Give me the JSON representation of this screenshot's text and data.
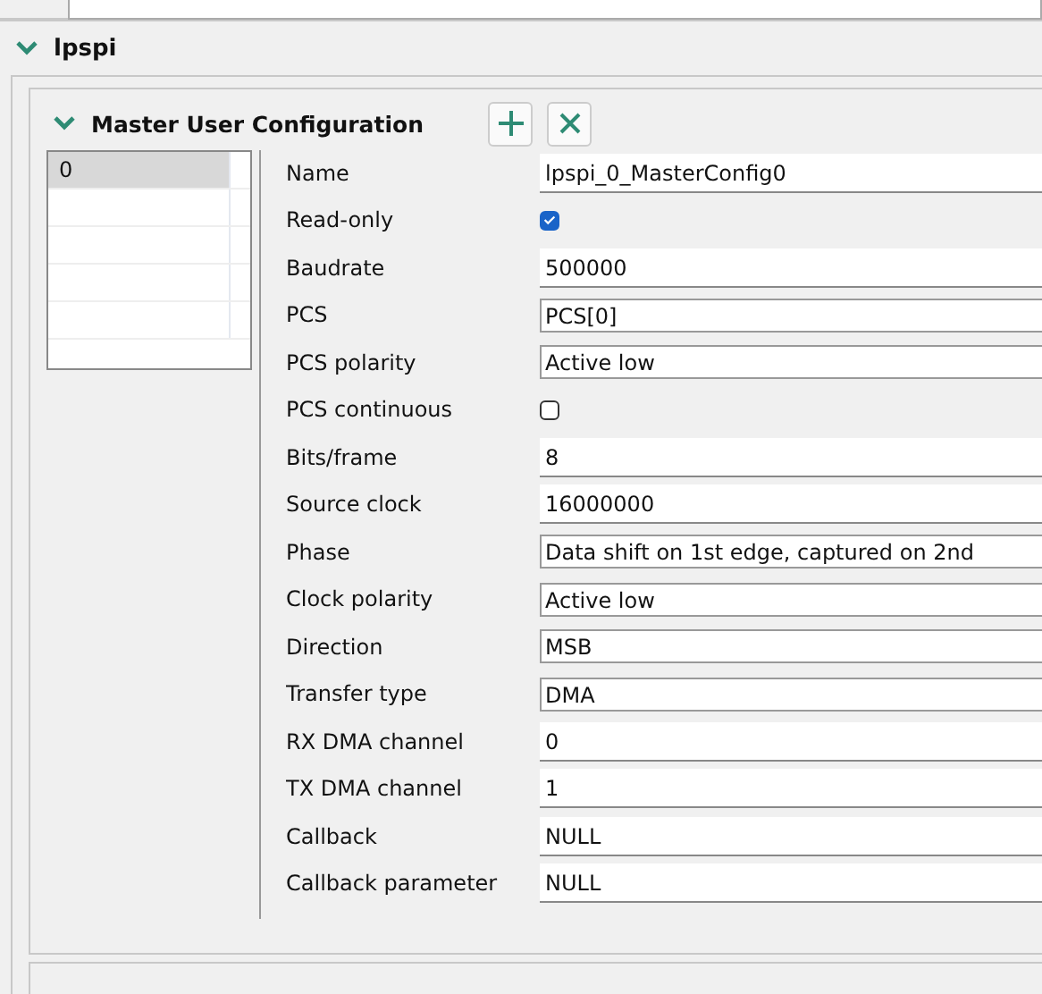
{
  "section": {
    "title": "lpspi",
    "expanded": true
  },
  "config": {
    "title": "Master User Configuration",
    "expanded": true,
    "list": [
      {
        "label": "0",
        "selected": true
      }
    ],
    "fields": [
      {
        "label": "Name",
        "kind": "text",
        "value": "lpspi_0_MasterConfig0"
      },
      {
        "label": "Read-only",
        "kind": "checkbox",
        "checked": true
      },
      {
        "label": "Baudrate",
        "kind": "text",
        "value": "500000"
      },
      {
        "label": "PCS",
        "kind": "combo",
        "value": "PCS[0]"
      },
      {
        "label": "PCS polarity",
        "kind": "combo",
        "value": "Active low"
      },
      {
        "label": "PCS continuous",
        "kind": "checkbox",
        "checked": false
      },
      {
        "label": "Bits/frame",
        "kind": "text",
        "value": "8"
      },
      {
        "label": "Source clock",
        "kind": "text",
        "value": "16000000"
      },
      {
        "label": "Phase",
        "kind": "combo",
        "value": "Data shift on 1st edge, captured on 2nd"
      },
      {
        "label": "Clock polarity",
        "kind": "combo",
        "value": "Active low"
      },
      {
        "label": "Direction",
        "kind": "combo",
        "value": "MSB"
      },
      {
        "label": "Transfer type",
        "kind": "combo",
        "value": "DMA"
      },
      {
        "label": "RX DMA channel",
        "kind": "text",
        "value": "0"
      },
      {
        "label": "TX DMA channel",
        "kind": "text",
        "value": "1"
      },
      {
        "label": "Callback",
        "kind": "text",
        "value": "NULL"
      },
      {
        "label": "Callback parameter",
        "kind": "text",
        "value": "NULL"
      }
    ]
  }
}
